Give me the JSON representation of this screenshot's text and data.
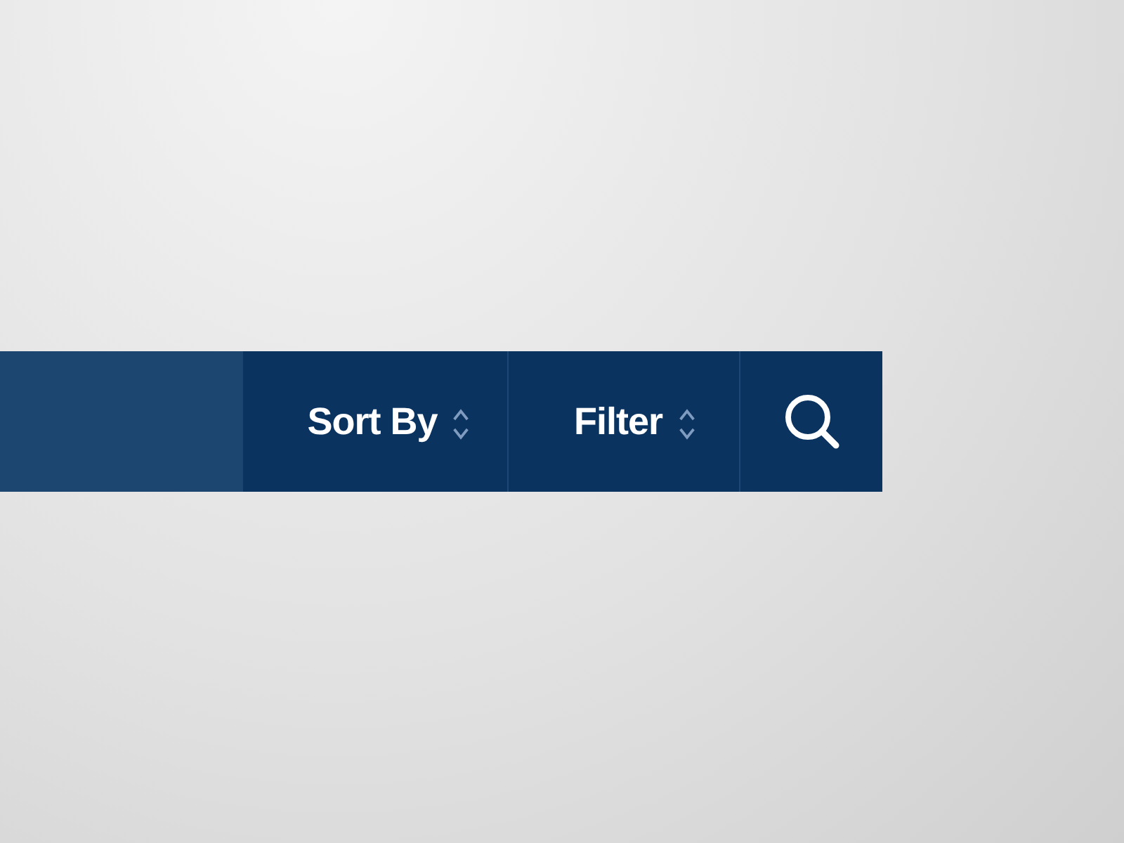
{
  "toolbar": {
    "buttons": [
      {
        "kind": "dropdown",
        "label": "Sort By"
      },
      {
        "kind": "dropdown",
        "label": "Filter"
      },
      {
        "kind": "search"
      }
    ]
  }
}
